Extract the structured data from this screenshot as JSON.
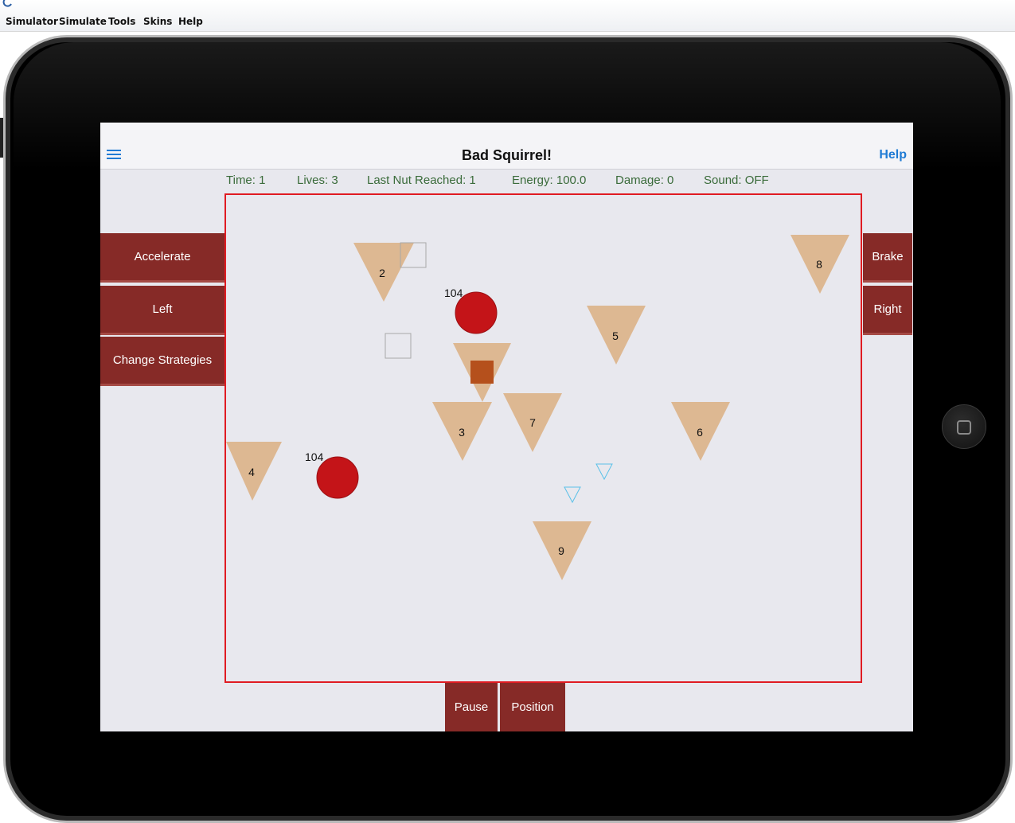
{
  "menu": {
    "items": [
      "Simulator",
      "Simulate",
      "Tools",
      "Skins",
      "Help"
    ]
  },
  "app": {
    "title": "Bad Squirrel!",
    "help_label": "Help"
  },
  "status": {
    "time": "Time: 1",
    "lives": "Lives: 3",
    "last_nut": "Last Nut Reached: 1",
    "energy": "Energy: 100.0",
    "damage": "Damage: 0",
    "sound": "Sound: OFF"
  },
  "controls": {
    "accelerate": "Accelerate",
    "left": "Left",
    "change_strategies": "Change Strategies",
    "brake": "Brake",
    "right": "Right",
    "pause": "Pause",
    "position": "Position"
  },
  "game": {
    "nuts": [
      {
        "label": "2"
      },
      {
        "label": "3"
      },
      {
        "label": "4"
      },
      {
        "label": "5"
      },
      {
        "label": "6"
      },
      {
        "label": "7"
      },
      {
        "label": "8"
      },
      {
        "label": "9"
      }
    ],
    "squirrels": [
      {
        "label": "104"
      },
      {
        "label": "104"
      }
    ],
    "colors": {
      "nut": "#ddb892",
      "squirrel": "#c41418",
      "player": "#b5501c",
      "bird": "#5bc0e8",
      "border": "#e01b22",
      "button": "#862a27"
    }
  }
}
